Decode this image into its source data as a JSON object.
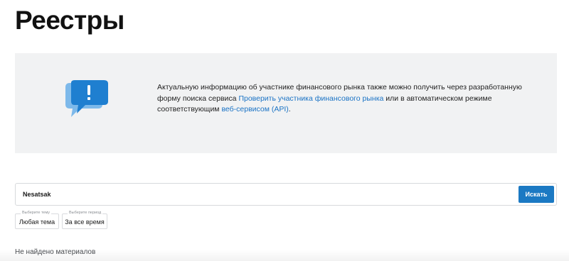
{
  "page": {
    "title": "Реестры"
  },
  "info": {
    "text_before": "Актуальную информацию об участнике финансового рынка также можно получить через разработанную форму поиска сервиса ",
    "link1": "Проверить участника финансового рынка",
    "text_middle": " или в автоматическом режиме соответствующим ",
    "link2": "веб-сервисом (API)",
    "text_after": ".",
    "icon": "exclamation-speech-bubble-icon"
  },
  "search": {
    "value": "Nesatsak",
    "button_label": "Искать"
  },
  "filters": {
    "topic": {
      "caption": "Выберите тему",
      "value": "Любая тема"
    },
    "period": {
      "caption": "Выберите период",
      "value": "За все время"
    }
  },
  "results": {
    "empty_message": "Не найдено материалов"
  },
  "colors": {
    "accent": "#1b79c3",
    "link": "#1a73c5",
    "banner_bg": "#f1f2f3",
    "icon_light": "#7db9ea",
    "icon_dark": "#1f7fd0"
  }
}
